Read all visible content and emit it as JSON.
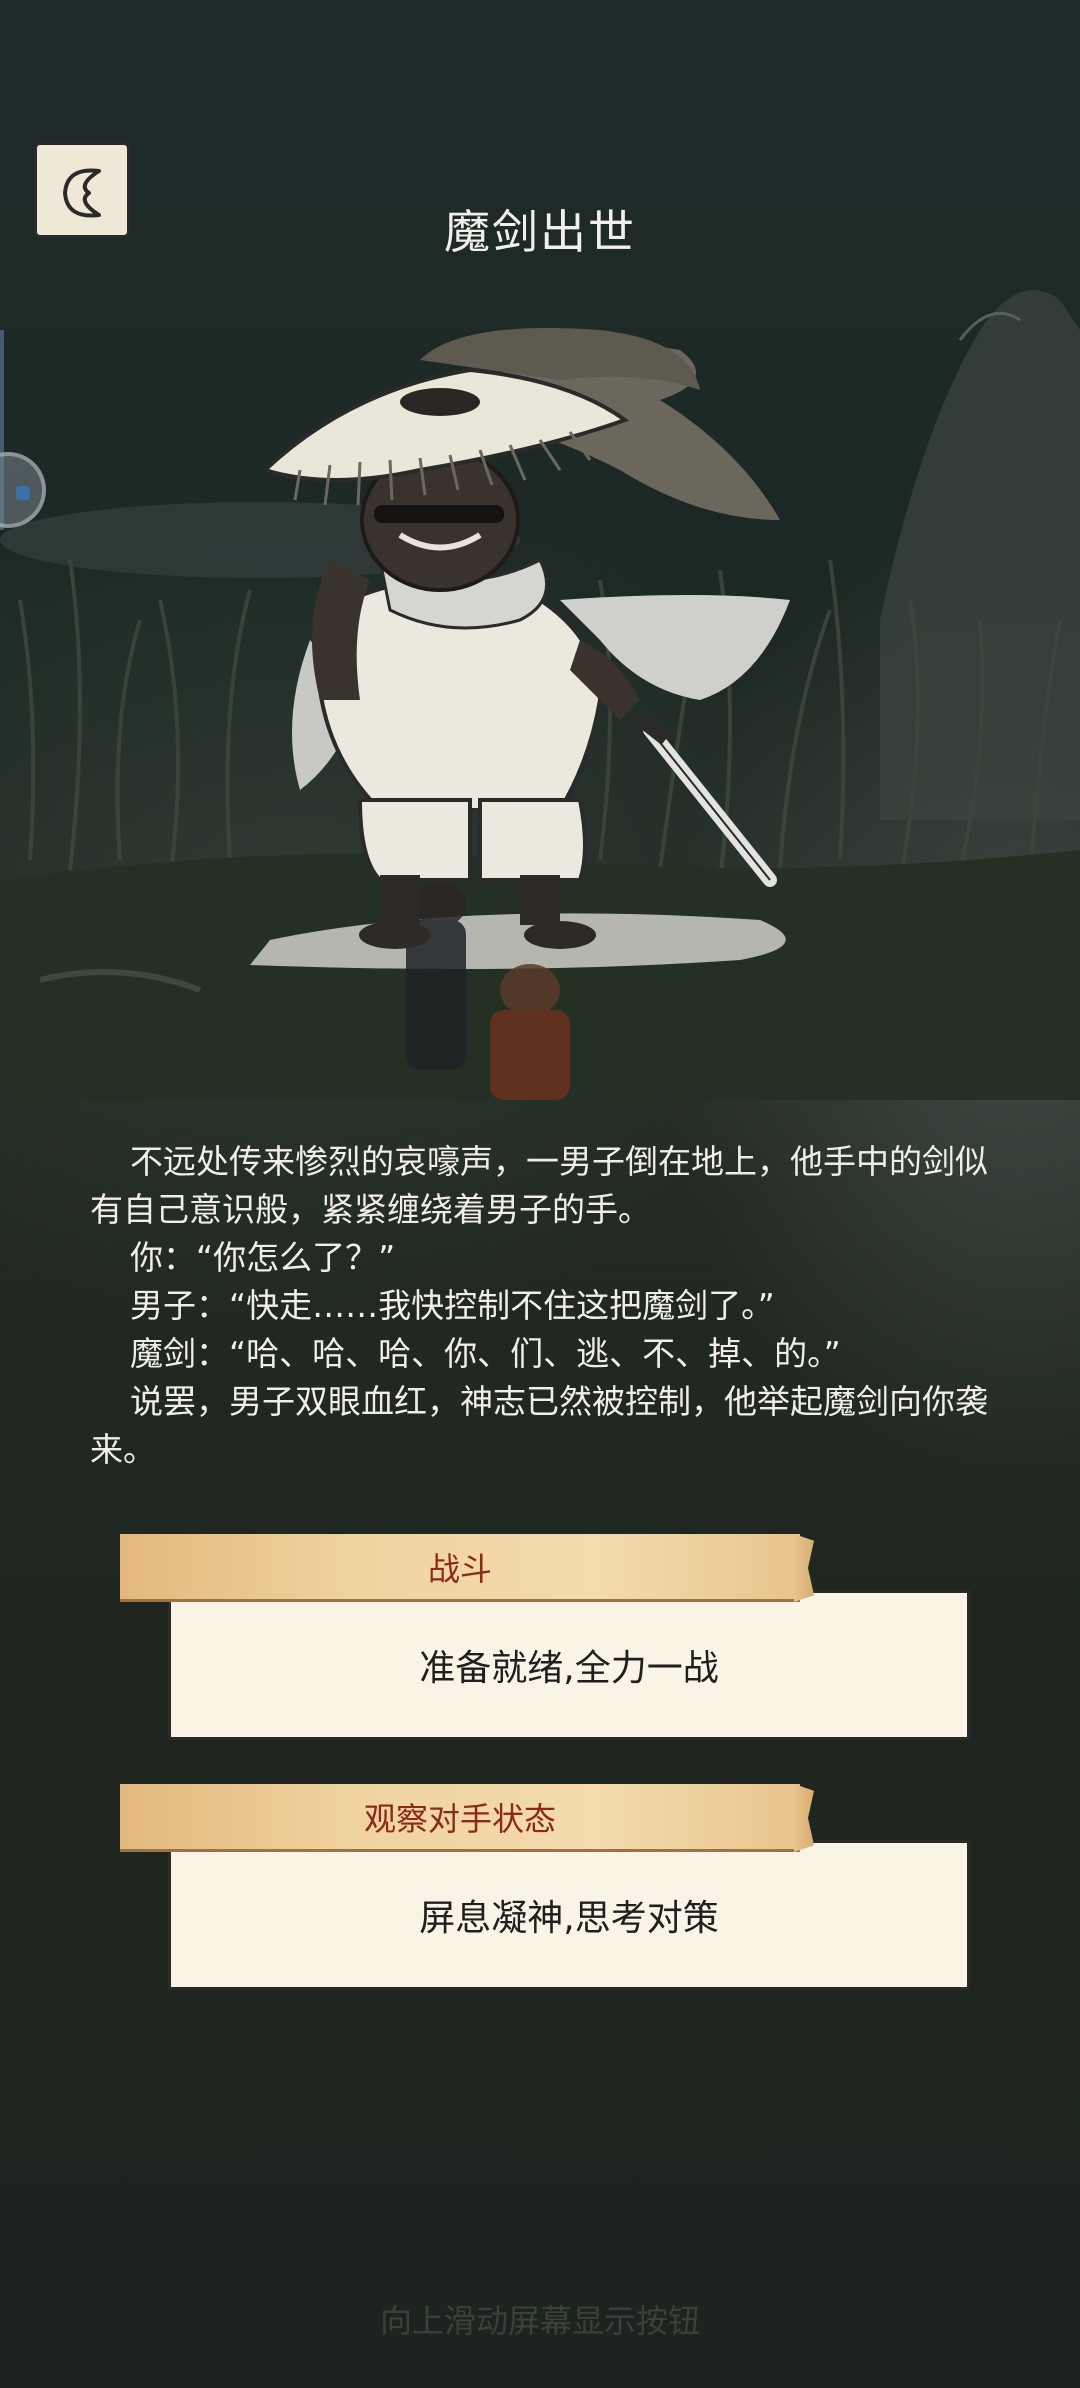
{
  "header": {
    "title": "魔剑出世"
  },
  "story": {
    "paragraphs": [
      "不远处传来惨烈的哀嚎声，一男子倒在地上，他手中的剑似有自己意识般，紧紧缠绕着男子的手。",
      "你：“你怎么了？”",
      "男子：“快走……我快控制不住这把魔剑了。”",
      "魔剑：“哈、哈、哈、你、们、逃、不、掉、的。”",
      "说罢，男子双眼血红，神志已然被控制，他举起魔剑向你袭来。"
    ]
  },
  "choices": [
    {
      "tag": "战斗",
      "text": "准备就绪,全力一战"
    },
    {
      "tag": "观察对手状态",
      "text": "屏息凝神,思考对策"
    }
  ],
  "footer": {
    "hint": "向上滑动屏幕显示按钮"
  },
  "colors": {
    "tag_text": "#8b2a1a",
    "card_bg": "#faf4e6",
    "tag_bg": "#f0d39f"
  },
  "icons": {
    "back": "back-arrow-icon"
  }
}
